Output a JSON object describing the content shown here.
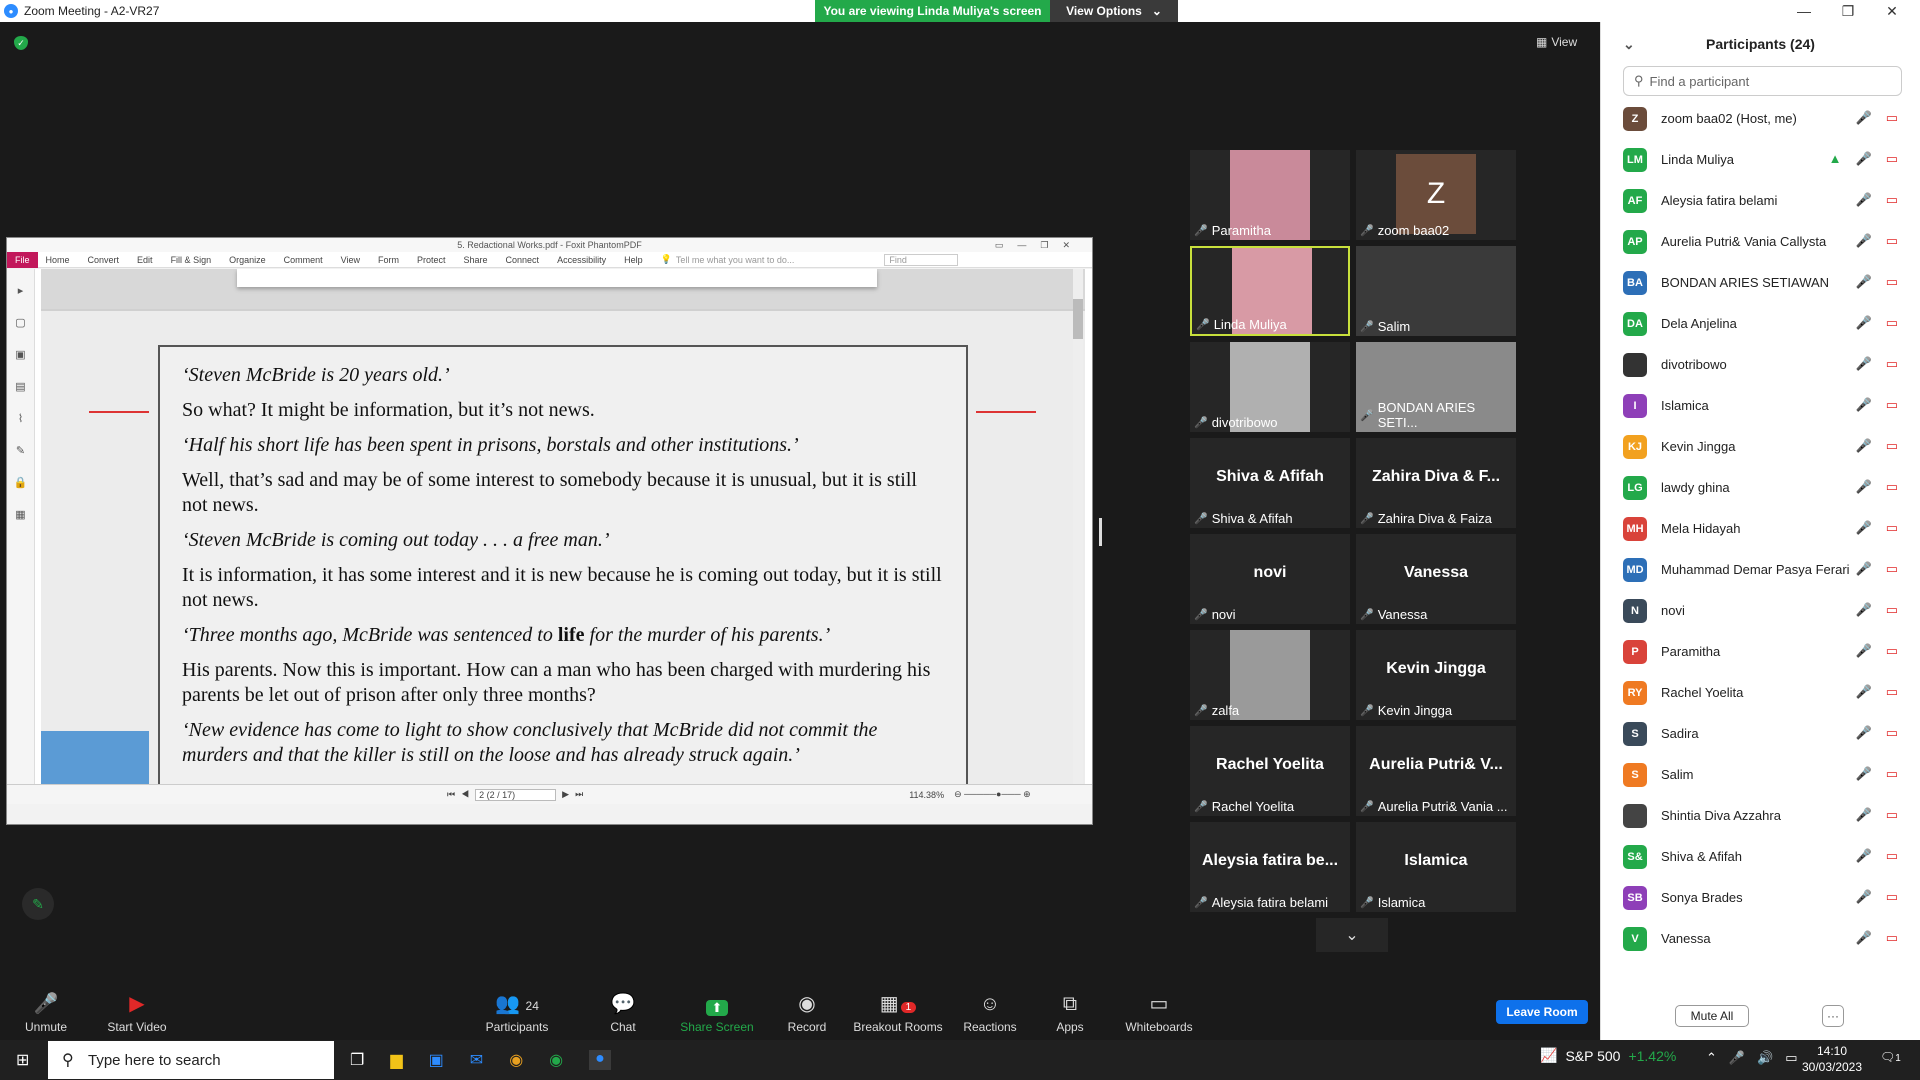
{
  "window": {
    "title": "Zoom Meeting - A2-VR27"
  },
  "banner": {
    "viewing": "You are viewing Linda Muliya's screen",
    "options": "View Options"
  },
  "view_button": "View",
  "foxit": {
    "title": "5. Redactional Works.pdf - Foxit PhantomPDF",
    "menu": [
      "File",
      "Home",
      "Convert",
      "Edit",
      "Fill & Sign",
      "Organize",
      "Comment",
      "View",
      "Form",
      "Protect",
      "Share",
      "Connect",
      "Accessibility",
      "Help"
    ],
    "tell_me": "Tell me what you want to do...",
    "find": "Find",
    "page_indicator": "2 (2 / 17)",
    "zoom": "114.38%"
  },
  "book": {
    "p1": "‘Steven McBride is 20 years old.’",
    "p2": "So what? It might be information, but it’s not news.",
    "p3": "‘Half his short life has been spent in prisons, borstals and other institutions.’",
    "p4": "Well, that’s sad and may be of some interest to somebody because it is unusual, but it is still not news.",
    "p5": "‘Steven McBride is coming out today . . . a free man.’",
    "p6": "It is information, it has some interest and it is new because he is coming out today, but it is still not news.",
    "p7a": "‘Three months ago, McBride was sentenced to ",
    "p7b": "life",
    "p7c": " for the murder of his parents.’",
    "p8": "His parents. Now this is important. How can a man who has been charged with murdering his parents be let out of prison after only three months?",
    "p9": "‘New evidence has come to light to show conclusively that McBride did not commit the murders and that the killer is still on the loose and has already struck again.’"
  },
  "gallery": [
    {
      "name": "Paramitha",
      "big": ""
    },
    {
      "name": "zoom baa02",
      "big": "Z"
    },
    {
      "name": "Linda Muliya",
      "big": ""
    },
    {
      "name": "Salim",
      "big": ""
    },
    {
      "name": "divotribowo",
      "big": ""
    },
    {
      "name": "BONDAN ARIES SETI...",
      "big": ""
    },
    {
      "name": "Shiva & Afifah",
      "big": "Shiva & Afifah"
    },
    {
      "name": "Zahira Diva & Faiza",
      "big": "Zahira Diva & F..."
    },
    {
      "name": "novi",
      "big": "novi"
    },
    {
      "name": "Vanessa",
      "big": "Vanessa"
    },
    {
      "name": "zalfa",
      "big": ""
    },
    {
      "name": "Kevin Jingga",
      "big": "Kevin Jingga"
    },
    {
      "name": "Rachel Yoelita",
      "big": "Rachel Yoelita"
    },
    {
      "name": "Aurelia Putri& Vania ...",
      "big": "Aurelia Putri& V..."
    },
    {
      "name": "Aleysia fatira belami",
      "big": "Aleysia fatira be..."
    },
    {
      "name": "Islamica",
      "big": "Islamica"
    }
  ],
  "panel": {
    "title": "Participants (24)",
    "search_placeholder": "Find a participant",
    "mute_all": "Mute All",
    "more": "···",
    "participants": [
      {
        "initials": "Z",
        "name": "zoom baa02 (Host, me)",
        "color": "#6b4c3b"
      },
      {
        "initials": "LM",
        "name": "Linda Muliya",
        "color": "#23a94a"
      },
      {
        "initials": "AF",
        "name": "Aleysia fatira belami",
        "color": "#23a94a"
      },
      {
        "initials": "AP",
        "name": "Aurelia Putri& Vania Callysta",
        "color": "#23a94a"
      },
      {
        "initials": "BA",
        "name": "BONDAN ARIES SETIAWAN",
        "color": "#2d6fb7"
      },
      {
        "initials": "DA",
        "name": "Dela Anjelina",
        "color": "#23a94a"
      },
      {
        "initials": "",
        "name": "divotribowo",
        "color": "#333333"
      },
      {
        "initials": "I",
        "name": "Islamica",
        "color": "#8e3fb8"
      },
      {
        "initials": "KJ",
        "name": "Kevin Jingga",
        "color": "#f2a11f"
      },
      {
        "initials": "LG",
        "name": "lawdy ghina",
        "color": "#23a94a"
      },
      {
        "initials": "MH",
        "name": "Mela Hidayah",
        "color": "#d9433a"
      },
      {
        "initials": "MD",
        "name": "Muhammad Demar Pasya Ferari",
        "color": "#2d6fb7"
      },
      {
        "initials": "N",
        "name": "novi",
        "color": "#3a4a5a"
      },
      {
        "initials": "P",
        "name": "Paramitha",
        "color": "#d9433a"
      },
      {
        "initials": "RY",
        "name": "Rachel Yoelita",
        "color": "#ef7a22"
      },
      {
        "initials": "S",
        "name": "Sadira",
        "color": "#3a4a5a"
      },
      {
        "initials": "S",
        "name": "Salim",
        "color": "#ef7a22"
      },
      {
        "initials": "",
        "name": "Shintia Diva Azzahra",
        "color": "#444444"
      },
      {
        "initials": "S&",
        "name": "Shiva & Afifah",
        "color": "#23a94a"
      },
      {
        "initials": "SB",
        "name": "Sonya Brades",
        "color": "#8e3fb8"
      },
      {
        "initials": "V",
        "name": "Vanessa",
        "color": "#23a94a"
      }
    ]
  },
  "toolbar": {
    "unmute": "Unmute",
    "start_video": "Start Video",
    "participants": "Participants",
    "participants_count": "24",
    "chat": "Chat",
    "share_screen": "Share Screen",
    "record": "Record",
    "breakout": "Breakout Rooms",
    "breakout_badge": "1",
    "reactions": "Reactions",
    "apps": "Apps",
    "whiteboards": "Whiteboards",
    "leave": "Leave Room"
  },
  "taskbar": {
    "search": "Type here to search",
    "stock": "S&P 500",
    "stock_change": "+1.42%",
    "time": "14:10",
    "date": "30/03/2023",
    "notif": "1"
  }
}
